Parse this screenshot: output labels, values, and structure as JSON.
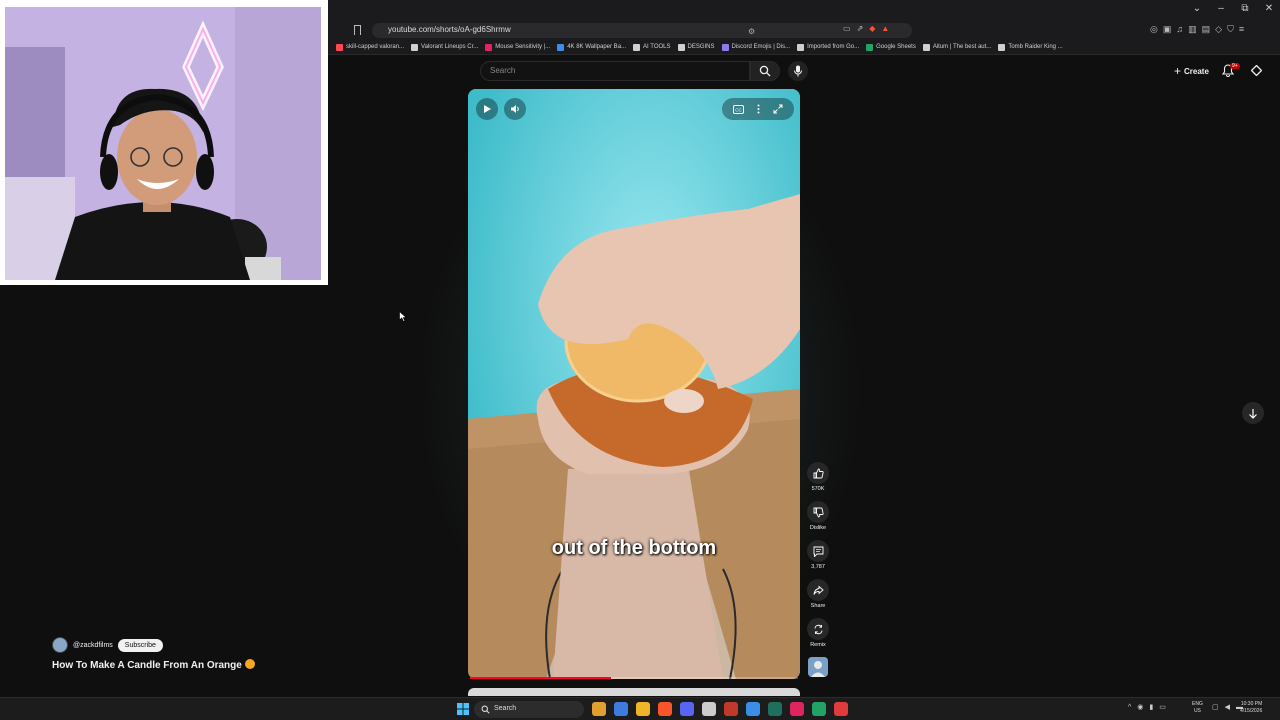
{
  "browser": {
    "url": "youtube.com/shorts/oA-gd6Shrmw",
    "window_controls": [
      "⌄",
      "–",
      "⧉",
      "✕"
    ]
  },
  "bookmarks": [
    {
      "label": "skill-capped valoran...",
      "color": "#ff4655"
    },
    {
      "label": "Valorant Lineups Cr...",
      "color": "#cfcfcf"
    },
    {
      "label": "Mouse Sensitivity |...",
      "color": "#e0245e"
    },
    {
      "label": "4K 8K Wallpaper Ba...",
      "color": "#3a8ee6"
    },
    {
      "label": "AI TOOLS",
      "color": "#cfcfcf"
    },
    {
      "label": "DESGINS",
      "color": "#cfcfcf"
    },
    {
      "label": "Discord Emojis | Dis...",
      "color": "#8a7cf0"
    },
    {
      "label": "Imported from Go...",
      "color": "#cfcfcf"
    },
    {
      "label": "Google Sheets",
      "color": "#21a366"
    },
    {
      "label": "Aitum | The best aut...",
      "color": "#cfcfcf"
    },
    {
      "label": "Tomb Raider King ...",
      "color": "#cfcfcf"
    }
  ],
  "youtube": {
    "search_placeholder": "Search",
    "create_label": "Create",
    "notification_badge": "9+"
  },
  "short": {
    "caption": "out of the bottom",
    "progress_fraction": 0.43,
    "likes": "570K",
    "dislike_label": "Dislike",
    "comments": "3,787",
    "share_label": "Share",
    "remix_label": "Remix",
    "channel_handle": "@zackdfilms",
    "subscribe_label": "Subscribe",
    "title": "How To Make A Candle From An Orange"
  },
  "taskbar": {
    "search_label": "Search",
    "lang_line1": "ENG",
    "lang_line2": "US",
    "time": "10:30 PM",
    "date": "4/15/2026",
    "icon_colors": [
      "#e0a030",
      "#3d7be0",
      "#f0b429",
      "#fb542b",
      "#5865f2",
      "#cccccc",
      "#c0392b",
      "#3a8ee6",
      "#1f6f5c",
      "#e0245e",
      "#21a366",
      "#e03c3c"
    ]
  }
}
